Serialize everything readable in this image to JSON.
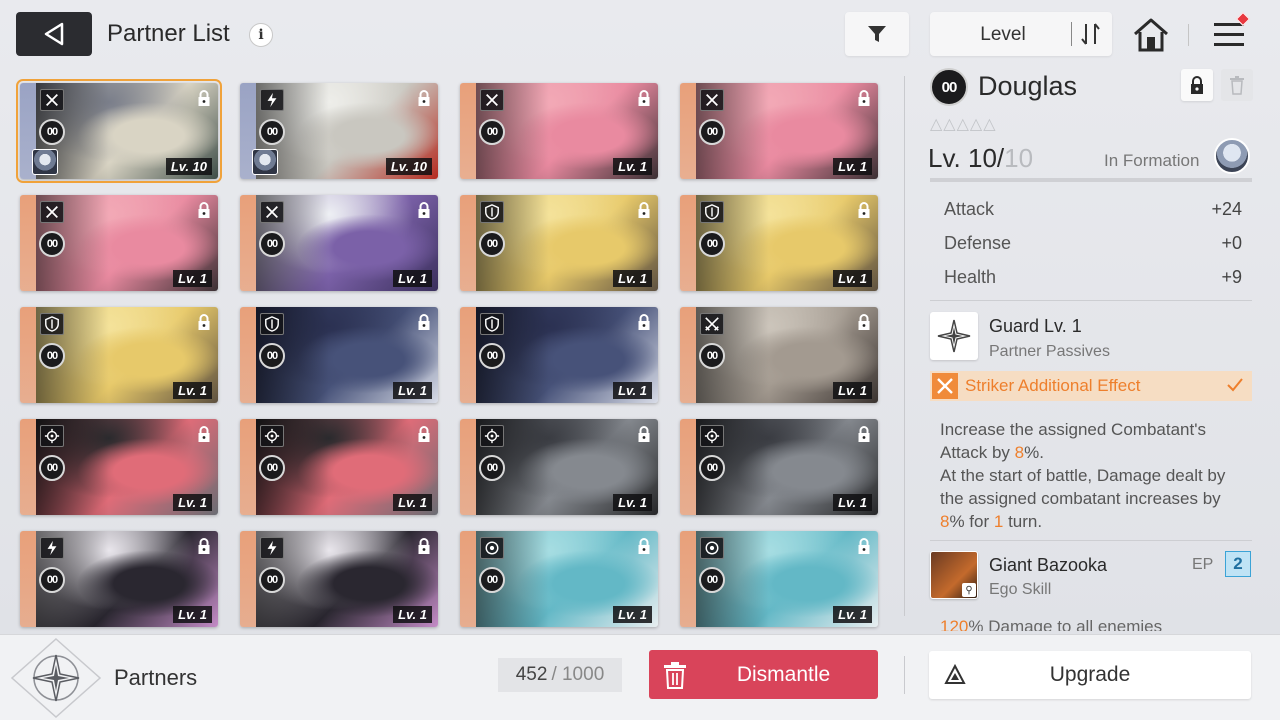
{
  "header": {
    "title": "Partner List",
    "info_glyph": "i",
    "sort_label": "Level"
  },
  "cards": [
    {
      "level": "Lv. 10",
      "class_icon": "striker-icon",
      "rank": "00",
      "colors": [
        "#7a7e8a",
        "#d9d4c4",
        "#3d4c47"
      ],
      "strip": "#9aa3c4",
      "selected": true,
      "equip": true
    },
    {
      "level": "Lv. 10",
      "class_icon": "lightning-icon",
      "rank": "00",
      "colors": [
        "#eeeeea",
        "#c9c7c0",
        "#b52a1f"
      ],
      "strip": "#9aa3c4",
      "equip": true
    },
    {
      "level": "Lv. 1",
      "class_icon": "striker-icon",
      "rank": "00",
      "colors": [
        "#f2a9b6",
        "#e98aa0",
        "#3a2f33"
      ],
      "strip": "#e8a07a"
    },
    {
      "level": "Lv. 1",
      "class_icon": "striker-icon",
      "rank": "00",
      "colors": [
        "#f2a9b6",
        "#e98aa0",
        "#3a2f33"
      ],
      "strip": "#e8a07a"
    },
    {
      "level": "Lv. 1",
      "class_icon": "striker-icon",
      "rank": "00",
      "colors": [
        "#f2a9b6",
        "#e98aa0",
        "#3a2f33"
      ],
      "strip": "#e8a07a"
    },
    {
      "level": "Lv. 1",
      "class_icon": "striker-icon",
      "rank": "00",
      "colors": [
        "#eef0f4",
        "#7b61a8",
        "#3a2f5c"
      ],
      "strip": "#e8a07a"
    },
    {
      "level": "Lv. 1",
      "class_icon": "shield-icon",
      "rank": "00",
      "colors": [
        "#f4e29a",
        "#e7c96a",
        "#5d5040"
      ],
      "strip": "#e8a07a"
    },
    {
      "level": "Lv. 1",
      "class_icon": "shield-icon",
      "rank": "00",
      "colors": [
        "#f4e29a",
        "#e7c96a",
        "#5d5040"
      ],
      "strip": "#e8a07a"
    },
    {
      "level": "Lv. 1",
      "class_icon": "shield-icon",
      "rank": "00",
      "colors": [
        "#f4e29a",
        "#e7c96a",
        "#5d5040"
      ],
      "strip": "#e8a07a"
    },
    {
      "level": "Lv. 1",
      "class_icon": "shield-icon",
      "rank": "00",
      "colors": [
        "#2b3152",
        "#475279",
        "#d9dde8"
      ],
      "strip": "#e8a07a"
    },
    {
      "level": "Lv. 1",
      "class_icon": "shield-icon",
      "rank": "00",
      "colors": [
        "#2b3152",
        "#475279",
        "#d9dde8"
      ],
      "strip": "#e8a07a"
    },
    {
      "level": "Lv. 1",
      "class_icon": "cross-swords-icon",
      "rank": "00",
      "colors": [
        "#ccc5bb",
        "#a39a90",
        "#3a3330"
      ],
      "strip": "#e8a07a"
    },
    {
      "level": "Lv. 1",
      "class_icon": "target-icon",
      "rank": "00",
      "colors": [
        "#2a2a2d",
        "#e06c78",
        "#6a6d74"
      ],
      "strip": "#e8a07a"
    },
    {
      "level": "Lv. 1",
      "class_icon": "target-icon",
      "rank": "00",
      "colors": [
        "#2a2a2d",
        "#e06c78",
        "#6a6d74"
      ],
      "strip": "#e8a07a"
    },
    {
      "level": "Lv. 1",
      "class_icon": "target-icon",
      "rank": "00",
      "colors": [
        "#3a3c42",
        "#85898f",
        "#262729"
      ],
      "strip": "#e8a07a"
    },
    {
      "level": "Lv. 1",
      "class_icon": "target-icon",
      "rank": "00",
      "colors": [
        "#3a3c42",
        "#85898f",
        "#262729"
      ],
      "strip": "#e8a07a"
    },
    {
      "level": "Lv. 1",
      "class_icon": "lightning-icon",
      "rank": "00",
      "colors": [
        "#e9e6ec",
        "#2a2730",
        "#c48cc7"
      ],
      "strip": "#e8a07a"
    },
    {
      "level": "Lv. 1",
      "class_icon": "lightning-icon",
      "rank": "00",
      "colors": [
        "#e9e6ec",
        "#2a2730",
        "#c48cc7"
      ],
      "strip": "#e8a07a"
    },
    {
      "level": "Lv. 1",
      "class_icon": "circle-dot-icon",
      "rank": "00",
      "colors": [
        "#a6dde2",
        "#63b8c6",
        "#e8eef0"
      ],
      "strip": "#e8a07a"
    },
    {
      "level": "Lv. 1",
      "class_icon": "circle-dot-icon",
      "rank": "00",
      "colors": [
        "#a6dde2",
        "#63b8c6",
        "#e8eef0"
      ],
      "strip": "#e8a07a"
    }
  ],
  "detail": {
    "rank": "00",
    "name": "Douglas",
    "stars": "△△△△△",
    "level_current": "Lv. 10/",
    "level_max": "10",
    "in_formation": "In Formation",
    "stats": [
      {
        "name": "Attack",
        "value": "+24"
      },
      {
        "name": "Defense",
        "value": "+0"
      },
      {
        "name": "Health",
        "value": "+9"
      }
    ],
    "passive": {
      "name": "Guard Lv. 1",
      "type": "Partner Passives",
      "effect_title": "Striker Additional Effect",
      "desc": {
        "l1": "Increase the assigned Combatant's",
        "l2a": "Attack by ",
        "l2v": "8",
        "l2b": "%.",
        "l3": "At the start of battle, Damage dealt by",
        "l4": "the assigned combatant increases by",
        "l5v1": "8",
        "l5a": "% for ",
        "l5v2": "1",
        "l5b": " turn."
      }
    },
    "skill": {
      "name": "Giant Bazooka",
      "type": "Ego Skill",
      "ep_label": "EP",
      "ep_value": "2",
      "desc_value": "120",
      "desc_text": "% Damage to all enemies"
    }
  },
  "bottom": {
    "title": "Partners",
    "count_current": "452",
    "count_total": "/ 1000",
    "dismantle_label": "Dismantle",
    "upgrade_label": "Upgrade"
  },
  "colors": {
    "accent_orange": "#ee7f2c",
    "dismantle_red": "#d9445a",
    "selected_outline": "#f0a23a"
  }
}
